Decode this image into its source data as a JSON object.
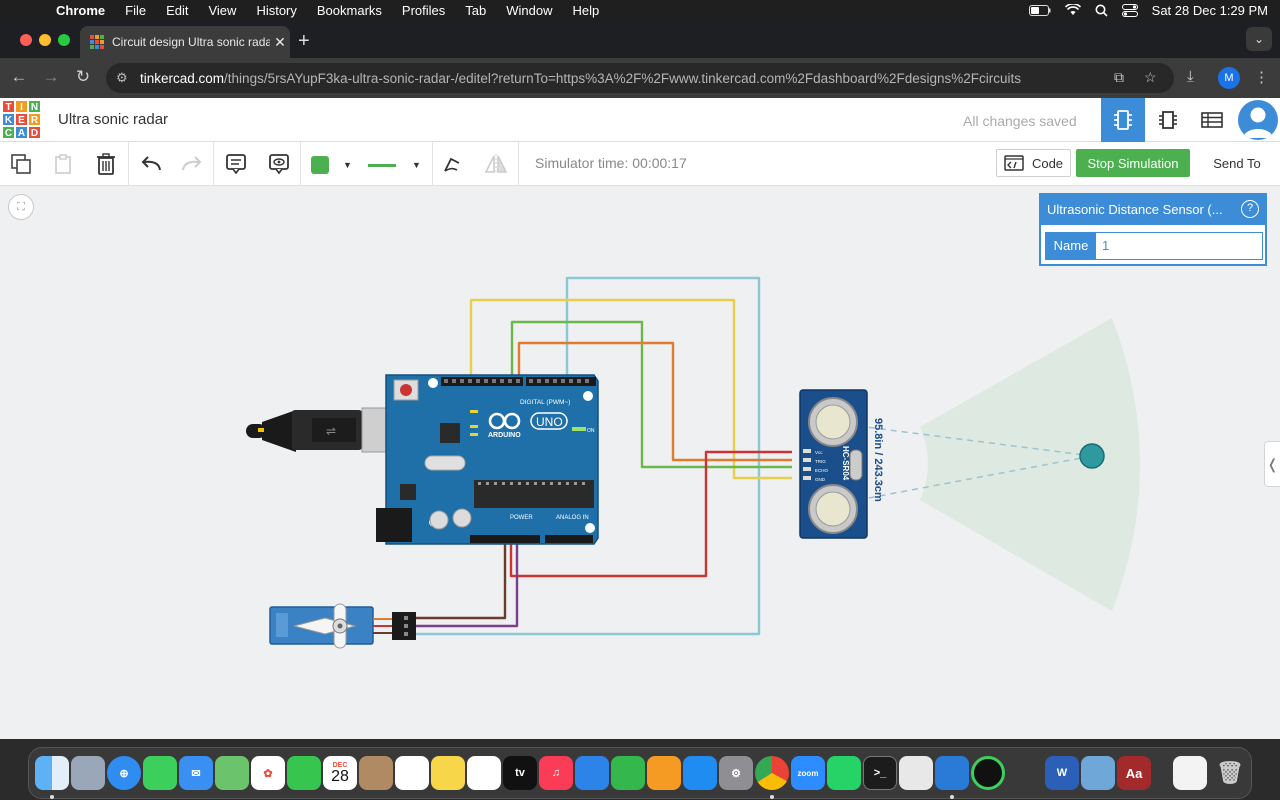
{
  "menubar": {
    "app": "Chrome",
    "items": [
      "File",
      "Edit",
      "View",
      "History",
      "Bookmarks",
      "Profiles",
      "Tab",
      "Window",
      "Help"
    ],
    "datetime": "Sat 28 Dec  1:29 PM"
  },
  "browser": {
    "tab_title": "Circuit design Ultra sonic radar",
    "url_host": "tinkercad.com",
    "url_path": "/things/5rsAYupF3ka-ultra-sonic-radar-/editel?returnTo=https%3A%2F%2Fwww.tinkercad.com%2Fdashboard%2Fdesigns%2Fcircuits",
    "profile_initial": "M"
  },
  "app": {
    "logo_letters": [
      "T",
      "I",
      "N",
      "K",
      "E",
      "R",
      "C",
      "A",
      "D"
    ],
    "design_title": "Ultra sonic radar",
    "save_status": "All changes saved"
  },
  "toolbar": {
    "sim_time": "Simulator time: 00:00:17",
    "code_label": "Code",
    "stop_label": "Stop Simulation",
    "send_label": "Send To",
    "fill_color": "#4caf50"
  },
  "inspector": {
    "title": "Ultrasonic Distance Sensor (...",
    "help": "?",
    "name_label": "Name",
    "name_value": "1"
  },
  "circuit": {
    "sensor_reading": "95.8in / 243.3cm",
    "arduino_brand": "ARDUINO",
    "arduino_model": "UNO",
    "digital_header": "DIGITAL (PWM~)",
    "power_header": "POWER",
    "analog_header": "ANALOG IN",
    "on_label": "ON",
    "sensor_model": "HC-SR04",
    "sensor_pins": [
      "Vcc",
      "TRIG",
      "ECHO",
      "GND"
    ]
  },
  "colors": {
    "accent": "#3c8cd8",
    "stop_green": "#4caf50",
    "wire_yellow": "#e8cf4b",
    "wire_green": "#6bb84a",
    "wire_orange": "#e07b30",
    "wire_blue": "#8cc7d6",
    "wire_red": "#cc3333",
    "wire_purple": "#7b3f8c",
    "wire_brown": "#6a3a2a",
    "arduino_board": "#1f6fa8"
  },
  "dock": {
    "calendar_month": "DEC",
    "calendar_day": "28",
    "apps": [
      "finder-icon",
      "launchpad-icon",
      "safari-icon",
      "messages-icon",
      "mail-icon",
      "maps-icon",
      "photos-icon",
      "facetime-icon",
      "calendar-icon",
      "contacts-icon",
      "reminders-icon",
      "notes-icon",
      "freeform-icon",
      "tv-icon",
      "music-icon",
      "keynote-icon",
      "numbers-icon",
      "pages-icon",
      "app-store-icon",
      "system-settings-icon",
      "chrome-icon",
      "zoom-icon",
      "whatsapp-icon",
      "terminal-icon",
      "python-icon",
      "vscode-icon",
      "activity-icon",
      "word-icon",
      "preview-icon",
      "dictionary-icon",
      "file-icon",
      "trash-icon"
    ],
    "tv_label": "tv",
    "zoom_label": "zoom",
    "dictionary_label": "Aa",
    "word_label": "W"
  }
}
